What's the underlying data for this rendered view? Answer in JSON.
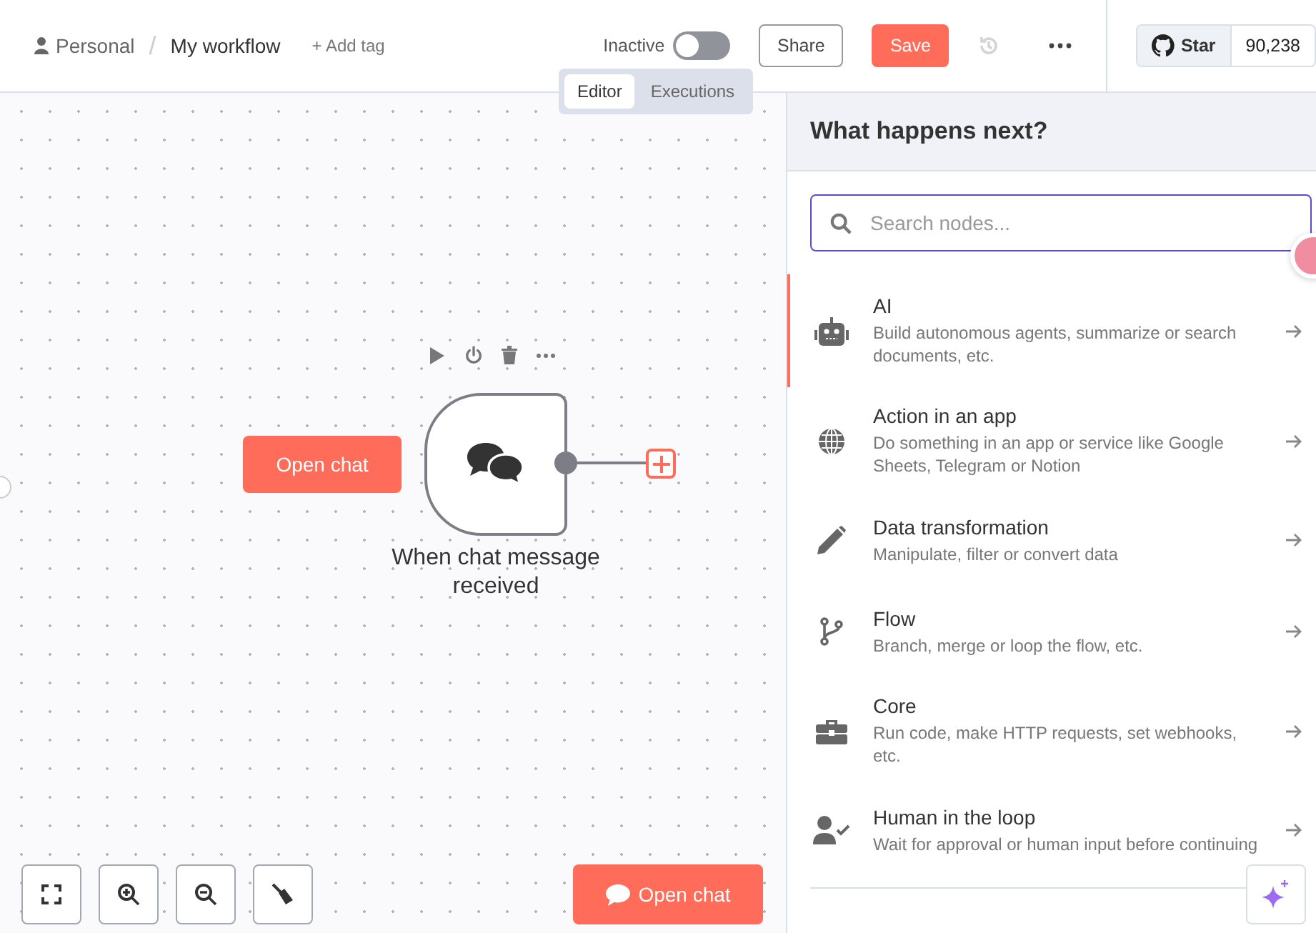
{
  "header": {
    "breadcrumb": {
      "project": "Personal",
      "separator": "/",
      "workflow": "My workflow"
    },
    "add_tag": "+ Add tag",
    "active_toggle": {
      "label": "Inactive",
      "on": false
    },
    "share": "Share",
    "save": "Save",
    "github": {
      "star": "Star",
      "count": "90,238"
    }
  },
  "view_tabs": [
    {
      "label": "Editor",
      "selected": true
    },
    {
      "label": "Executions",
      "selected": false
    }
  ],
  "canvas": {
    "open_chat_node": "Open chat",
    "node": {
      "label": "When chat message received"
    },
    "bottom_button": "Open chat"
  },
  "panel": {
    "title": "What happens next?",
    "search": {
      "placeholder": "Search nodes..."
    },
    "categories": [
      {
        "title": "AI",
        "description": "Build autonomous agents, summarize or search documents, etc.",
        "selected": true
      },
      {
        "title": "Action in an app",
        "description": "Do something in an app or service like Google Sheets, Telegram or Notion",
        "selected": false
      },
      {
        "title": "Data transformation",
        "description": "Manipulate, filter or convert data",
        "selected": false
      },
      {
        "title": "Flow",
        "description": "Branch, merge or loop the flow, etc.",
        "selected": false
      },
      {
        "title": "Core",
        "description": "Run code, make HTTP requests, set webhooks, etc.",
        "selected": false
      },
      {
        "title": "Human in the loop",
        "description": "Wait for approval or human input before continuing",
        "selected": false
      }
    ]
  }
}
